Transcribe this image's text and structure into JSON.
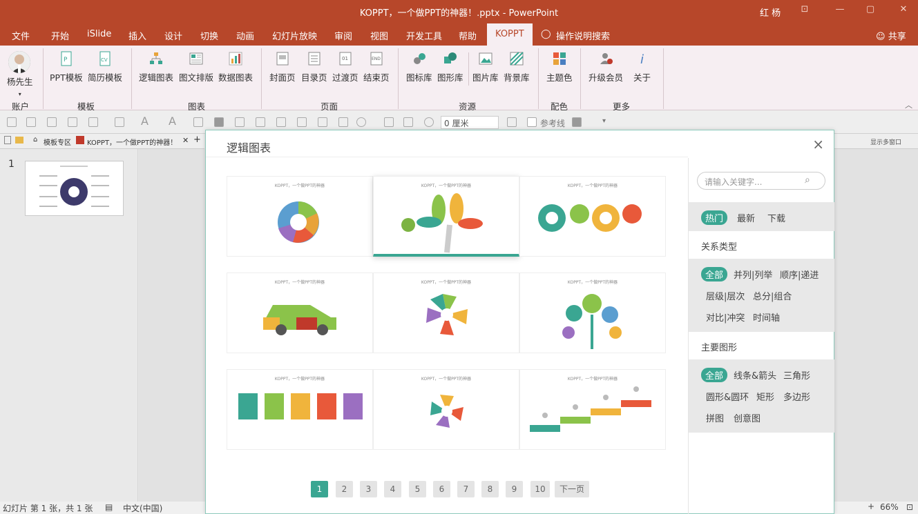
{
  "window": {
    "title": "KOPPT，一个做PPT的神器！.pptx - PowerPoint",
    "user": "红 杨",
    "min_label": "—",
    "max_label": "▢",
    "close_label": "✕"
  },
  "menu": {
    "items": [
      "文件",
      "开始",
      "iSlide",
      "插入",
      "设计",
      "切换",
      "动画",
      "幻灯片放映",
      "审阅",
      "视图",
      "开发工具",
      "帮助",
      "KOPPT"
    ],
    "tell": "操作说明搜索",
    "share": "共享"
  },
  "ribbon": {
    "account": {
      "name": "杨先生",
      "group": "账户"
    },
    "template": {
      "buttons": [
        "PPT模板",
        "简历模板"
      ],
      "group": "模板"
    },
    "chart": {
      "buttons": [
        "逻辑图表",
        "图文排版",
        "数据图表"
      ],
      "group": "图表"
    },
    "page": {
      "buttons": [
        "封面页",
        "目录页",
        "过渡页",
        "结束页"
      ],
      "group": "页面"
    },
    "resource": {
      "buttons": [
        "图标库",
        "图形库",
        "图片库",
        "背景库"
      ],
      "group": "资源"
    },
    "color": {
      "buttons": [
        "主题色"
      ],
      "group": "配色"
    },
    "more": {
      "buttons": [
        "升级会员",
        "关于"
      ],
      "group": "更多"
    }
  },
  "toolbar": {
    "size_value": "0 厘米",
    "guide": "参考线"
  },
  "tabs": {
    "t1": "模板专区",
    "t2": "KOPPT，一个做PPT的神器！.pptx",
    "extra": "显示多窗口"
  },
  "slides": {
    "number": "1"
  },
  "status": {
    "slide": "幻灯片 第 1 张，共 1 张",
    "lang": "中文(中国)",
    "zoom": "66%"
  },
  "dialog": {
    "title": "逻辑图表",
    "card_caption": "KOPPT，一个做PPT的神器",
    "pages": [
      "1",
      "2",
      "3",
      "4",
      "5",
      "6",
      "7",
      "8",
      "9",
      "10",
      "下一页"
    ],
    "search_placeholder": "请输入关键字...",
    "sort": [
      "热门",
      "最新",
      "下载"
    ],
    "relation_title": "关系类型",
    "relations": [
      "全部",
      "并列|列举",
      "顺序|递进",
      "层级|层次",
      "总分|组合",
      "对比|冲突",
      "时间轴"
    ],
    "shape_title": "主要图形",
    "shapes": [
      "全部",
      "线条&箭头",
      "三角形",
      "圆形&圆环",
      "矩形",
      "多边形",
      "拼图",
      "创意图"
    ]
  },
  "colors": {
    "accent": "#b7472a",
    "teal": "#3aa692",
    "ribbon_bg": "#f6eef2"
  }
}
